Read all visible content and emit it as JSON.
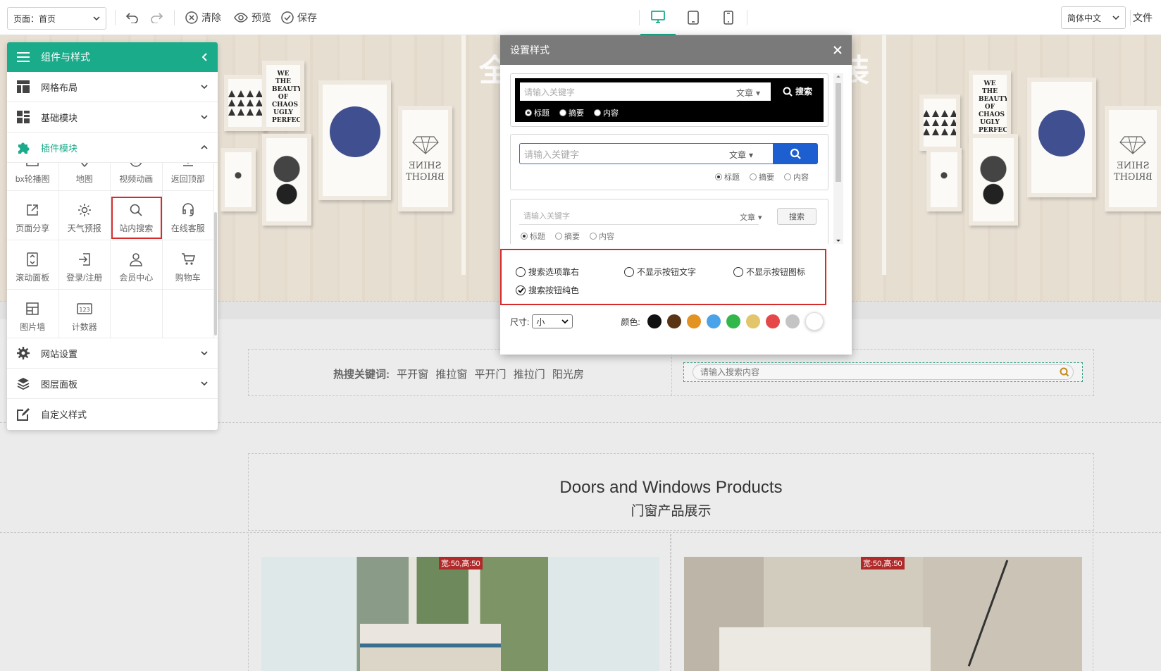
{
  "toolbar": {
    "page_select": "页面：首页",
    "actions": {
      "clear": "清除",
      "preview": "预览",
      "save": "保存"
    },
    "devices": [
      "desktop-icon",
      "tablet-icon",
      "mobile-icon"
    ],
    "language": "简体中文",
    "file_menu": "文件"
  },
  "panel": {
    "title": "组件与样式",
    "sections": [
      {
        "label": "网格布局",
        "icon": "grid-layout-icon"
      },
      {
        "label": "基础模块",
        "icon": "basic-module-icon"
      },
      {
        "label": "插件模块",
        "icon": "plugin-puzzle-icon"
      }
    ],
    "plugins": [
      {
        "label": "bx轮播图",
        "icon": "carousel-icon"
      },
      {
        "label": "地图",
        "icon": "map-icon"
      },
      {
        "label": "视频动画",
        "icon": "video-icon"
      },
      {
        "label": "返回顶部",
        "icon": "back-top-icon"
      },
      {
        "label": "页面分享",
        "icon": "share-icon"
      },
      {
        "label": "天气预报",
        "icon": "weather-icon"
      },
      {
        "label": "站内搜索",
        "icon": "search-icon"
      },
      {
        "label": "在线客服",
        "icon": "customer-service-icon"
      },
      {
        "label": "滚动面板",
        "icon": "scroll-panel-icon"
      },
      {
        "label": "登录/注册",
        "icon": "login-icon"
      },
      {
        "label": "会员中心",
        "icon": "user-icon"
      },
      {
        "label": "购物车",
        "icon": "cart-icon"
      },
      {
        "label": "图片墙",
        "icon": "image-wall-icon"
      },
      {
        "label": "计数器",
        "icon": "counter-icon"
      }
    ],
    "bottom_sections": [
      {
        "label": "网站设置",
        "icon": "gear-icon"
      },
      {
        "label": "图层面板",
        "icon": "layers-icon"
      },
      {
        "label": "自定义样式",
        "icon": "edit-icon"
      }
    ]
  },
  "modal": {
    "title": "设置样式",
    "styles": [
      {
        "placeholder": "请输入关键字",
        "category": "文章",
        "button": "搜索",
        "radios": [
          "标题",
          "摘要",
          "内容"
        ]
      },
      {
        "placeholder": "请输入关键字",
        "category": "文章",
        "radios": [
          "标题",
          "摘要",
          "内容"
        ]
      },
      {
        "placeholder": "请输入关键字",
        "category": "文章",
        "button": "搜索",
        "radios": [
          "标题",
          "摘要",
          "内容"
        ]
      }
    ],
    "options": [
      {
        "label": "搜索选项靠右",
        "checked": false
      },
      {
        "label": "不显示按钮文字",
        "checked": false
      },
      {
        "label": "不显示按钮图标",
        "checked": false
      },
      {
        "label": "搜索按钮纯色",
        "checked": true
      }
    ],
    "size_label": "尺寸:",
    "size_value": "小",
    "color_label": "颜色:",
    "colors": [
      "#111111",
      "#5a3515",
      "#e39322",
      "#4aa3e8",
      "#31b74a",
      "#e3c56b",
      "#e44848",
      "#c4c4c4",
      "#ffffff"
    ]
  },
  "canvas": {
    "hot_label": "热搜关键词:",
    "hot_words": [
      "平开窗",
      "推拉窗",
      "平开门",
      "推拉门",
      "阳光房"
    ],
    "search_placeholder": "请输入搜索内容",
    "products_title_en": "Doors and Windows Products",
    "products_title_cn": "门窗产品展示",
    "size_badge": "宽:50,高:50",
    "banner_title": "全",
    "banner_title_right": "装",
    "frame_texts": {
      "left_poster": "WE THE BEAUTY OF CHAOS UGLY PERFECTION",
      "shine": "SHINE BRIGHT"
    }
  }
}
